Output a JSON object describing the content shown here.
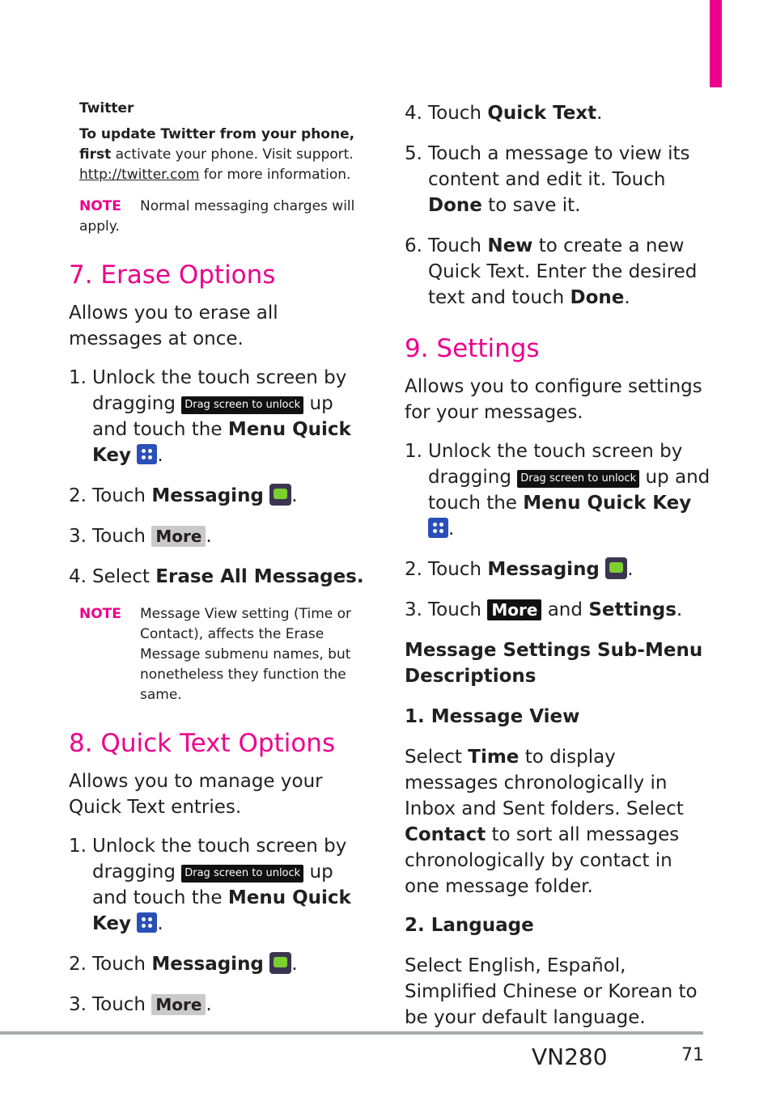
{
  "left": {
    "twitter_title": "Twitter",
    "twitter_bold": "To update Twitter from your phone, first",
    "twitter_rest": " activate your phone. Visit support.",
    "twitter_link": "http://twitter.com",
    "twitter_after": " for more information.",
    "note1_label": "NOTE",
    "note1_text": "Normal messaging charges will apply.",
    "sec7_title": "7. Erase Options",
    "sec7_intro": "Allows you to erase all messages at once.",
    "sec7_s1a": "Unlock the touch screen by dragging ",
    "sec7_s1b": " up and touch the ",
    "sec7_s1key": "Menu Quick Key",
    "sec7_s2a": "Touch ",
    "sec7_s2b": "Messaging",
    "sec7_s3a": "Touch ",
    "sec7_s4a": "Select ",
    "sec7_s4b": "Erase All Messages.",
    "note2_label": "NOTE",
    "note2_text": "Message View setting (Time or Contact), affects the Erase Message submenu names, but nonetheless they function the same.",
    "sec8_title": "8. Quick Text Options",
    "sec8_intro": "Allows you to manage your Quick Text entries."
  },
  "right": {
    "s4a": "Touch ",
    "s4b": "Quick Text",
    "s5a": "Touch a message to view its content and edit it. Touch ",
    "s5b": "Done",
    "s5c": " to save it.",
    "s6a": "Touch ",
    "s6b": "New",
    "s6c": " to create a new Quick Text. Enter the desired text and touch ",
    "s6d": "Done",
    "sec9_title": "9. Settings",
    "sec9_intro": "Allows you to configure settings for your messages.",
    "s3c": " and ",
    "s3d": "Settings",
    "sub_title": "Message Settings Sub-Menu Descriptions",
    "mv_title": "1. Message View",
    "mv_a": "Select ",
    "mv_b": "Time",
    "mv_c": " to display messages chronologically in Inbox and Sent folders. Select ",
    "mv_d": "Contact",
    "mv_e": " to sort all messages chronologically by contact in one message folder.",
    "lang_title": "2. Language",
    "lang_text": "Select English, Español, Simplified Chinese or Korean to be your default language."
  },
  "common": {
    "drag_label": "Drag screen to unlock",
    "more_label": "More",
    "unlock_a": "Unlock the touch screen by dragging ",
    "unlock_b": " up and touch the ",
    "menu_key": "Menu Quick Key",
    "touch": "Touch ",
    "messaging": "Messaging",
    "n1": "1.",
    "n2": "2.",
    "n3": "3.",
    "n4": "4.",
    "n5": "5.",
    "n6": "6."
  },
  "footer": {
    "model": "VN280",
    "page": "71"
  },
  "colors": {
    "accent": "#ec008c"
  }
}
